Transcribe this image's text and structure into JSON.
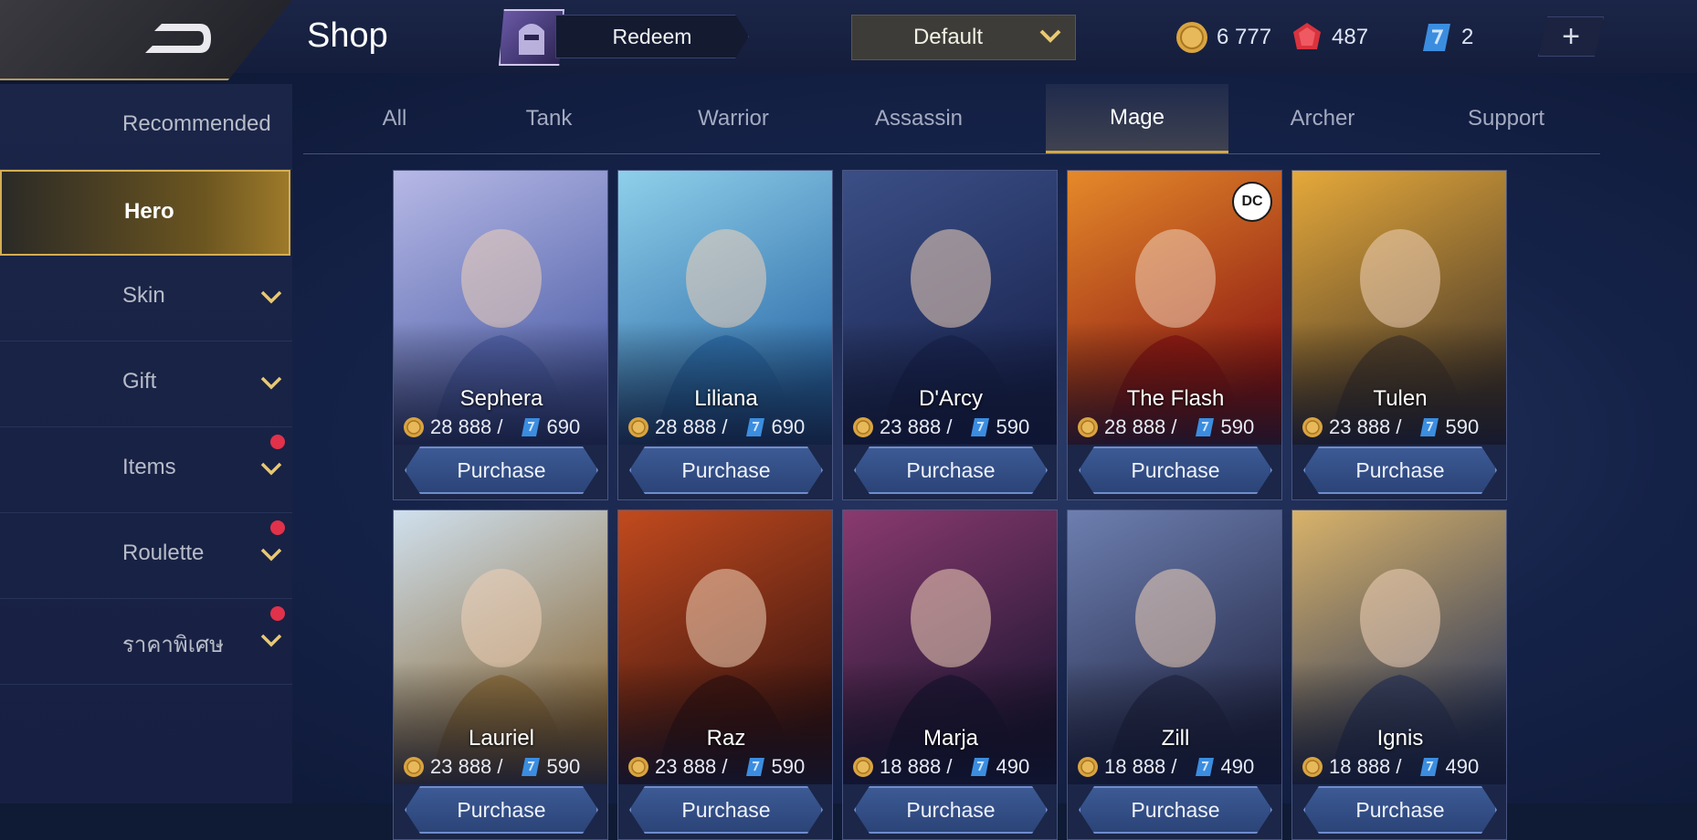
{
  "header": {
    "title": "Shop",
    "redeem_label": "Redeem",
    "sort_label": "Default",
    "currencies": [
      {
        "name": "battle-points",
        "value": "6 777",
        "color": "#d9a441"
      },
      {
        "name": "diamonds",
        "value": "487",
        "color": "#d8333e"
      },
      {
        "name": "vouchers",
        "value": "2",
        "color": "#3b8de0"
      }
    ],
    "plus_label": "+"
  },
  "sidebar": {
    "items": [
      {
        "label": "Recommended",
        "has_chevron": false,
        "badge": false,
        "active": false
      },
      {
        "label": "Hero",
        "has_chevron": false,
        "badge": false,
        "active": true
      },
      {
        "label": "Skin",
        "has_chevron": true,
        "badge": false,
        "active": false
      },
      {
        "label": "Gift",
        "has_chevron": true,
        "badge": false,
        "active": false
      },
      {
        "label": "Items",
        "has_chevron": true,
        "badge": true,
        "active": false
      },
      {
        "label": "Roulette",
        "has_chevron": true,
        "badge": true,
        "active": false
      },
      {
        "label": "ราคาพิเศษ",
        "has_chevron": true,
        "badge": true,
        "active": false
      }
    ]
  },
  "tabs": [
    {
      "label": "All",
      "active": false
    },
    {
      "label": "Tank",
      "active": false
    },
    {
      "label": "Warrior",
      "active": false
    },
    {
      "label": "Assassin",
      "active": false
    },
    {
      "label": "Mage",
      "active": true
    },
    {
      "label": "Archer",
      "active": false
    },
    {
      "label": "Support",
      "active": false
    }
  ],
  "heroes": [
    {
      "name": "Sephera",
      "bp": "28 888 /",
      "ticket": "690",
      "button": "Purchase",
      "c1": "#b7b9e6",
      "c2": "#4e5fa8",
      "dc": false
    },
    {
      "name": "Liliana",
      "bp": "28 888 /",
      "ticket": "690",
      "button": "Purchase",
      "c1": "#8fd0ea",
      "c2": "#2b6aa8",
      "dc": false
    },
    {
      "name": "D'Arcy",
      "bp": "23 888 /",
      "ticket": "590",
      "button": "Purchase",
      "c1": "#3b4f86",
      "c2": "#1a2552",
      "dc": false
    },
    {
      "name": "The Flash",
      "bp": "28 888 /",
      "ticket": "590",
      "button": "Purchase",
      "c1": "#e58a2a",
      "c2": "#8a1512",
      "dc": true
    },
    {
      "name": "Tulen",
      "bp": "23 888 /",
      "ticket": "590",
      "button": "Purchase",
      "c1": "#e6a93a",
      "c2": "#4a3b2a",
      "dc": false
    },
    {
      "name": "Lauriel",
      "bp": "23 888 /",
      "ticket": "590",
      "button": "Purchase",
      "c1": "#cfe0ee",
      "c2": "#8a6a3a",
      "dc": false
    },
    {
      "name": "Raz",
      "bp": "23 888 /",
      "ticket": "590",
      "button": "Purchase",
      "c1": "#c24a1e",
      "c2": "#3a1410",
      "dc": false
    },
    {
      "name": "Marja",
      "bp": "18 888 /",
      "ticket": "490",
      "button": "Purchase",
      "c1": "#8a3a6e",
      "c2": "#1e1634",
      "dc": false
    },
    {
      "name": "Zill",
      "bp": "18 888 /",
      "ticket": "490",
      "button": "Purchase",
      "c1": "#6d7fb0",
      "c2": "#252a4a",
      "dc": false
    },
    {
      "name": "Ignis",
      "bp": "18 888 /",
      "ticket": "490",
      "button": "Purchase",
      "c1": "#d9b36a",
      "c2": "#2f3a5a",
      "dc": false
    }
  ],
  "dc_badge": "DC"
}
